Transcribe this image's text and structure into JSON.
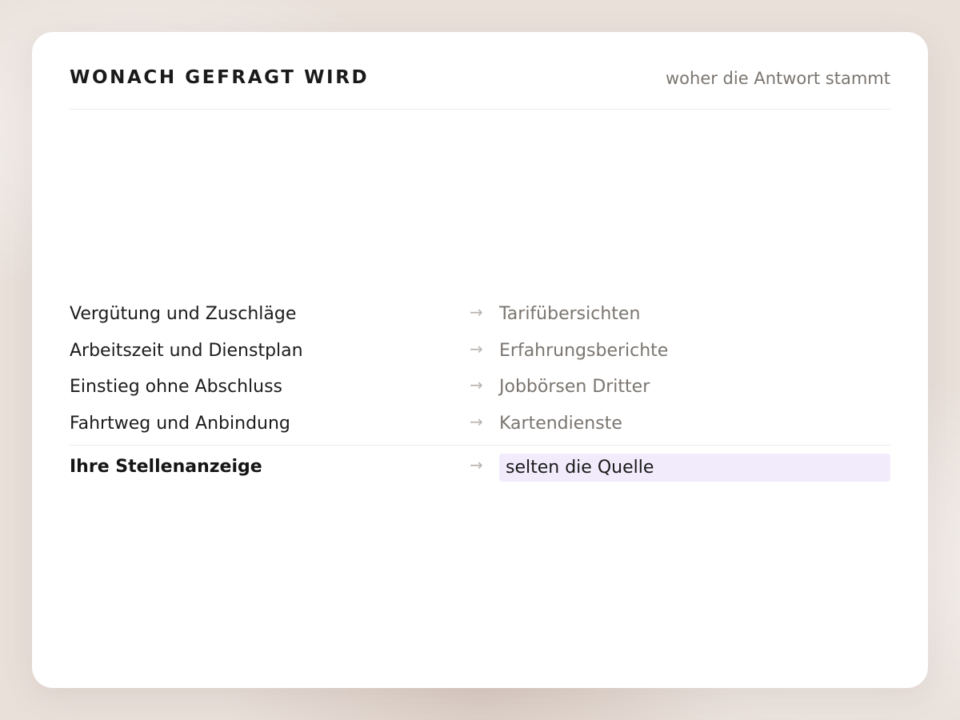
{
  "header": {
    "title": "WONACH GEFRAGT WIRD",
    "subtitle": "woher die Antwort stammt"
  },
  "rows": [
    {
      "topic": "Vergütung und Zuschläge",
      "arrow": "→",
      "source": "Tarifübersichten"
    },
    {
      "topic": "Arbeitszeit und Dienstplan",
      "arrow": "→",
      "source": "Erfahrungsberichte"
    },
    {
      "topic": "Einstieg ohne Abschluss",
      "arrow": "→",
      "source": "Jobbörsen Dritter"
    },
    {
      "topic": "Fahrtweg und Anbindung",
      "arrow": "→",
      "source": "Kartendienste"
    }
  ],
  "highlight": {
    "topic": "Ihre Stellenanzeige",
    "arrow": "→",
    "source": "selten die Quelle",
    "highlight_color": "#f1ebfb"
  },
  "colors": {
    "text_primary": "#1c1c1c",
    "text_muted": "#7a7570",
    "arrow": "#b9b5b1",
    "card_background": "#ffffff",
    "page_background": "#e9e0da"
  }
}
